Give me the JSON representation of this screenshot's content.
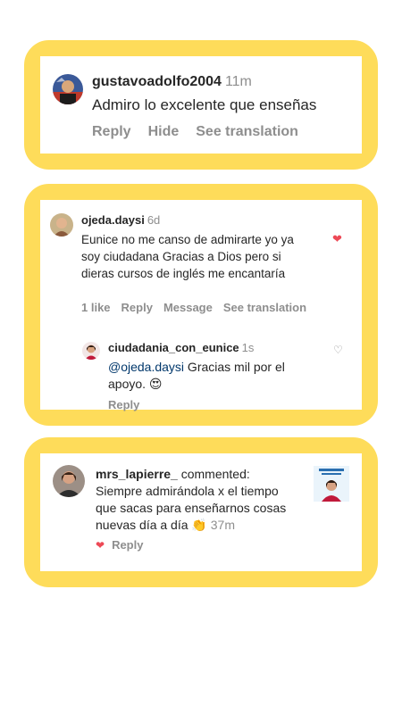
{
  "comment1": {
    "username": "gustavoadolfo2004",
    "time": "11m",
    "text": "Admiro lo excelente que enseñas",
    "actions": [
      "Reply",
      "Hide",
      "See translation"
    ]
  },
  "comment2": {
    "username": "ojeda.daysi",
    "time": "6d",
    "text": "Eunice no me canso de admirarte yo ya soy ciudadana Gracias a Dios pero si dieras cursos de inglés me encantaría",
    "actions": [
      "1 like",
      "Reply",
      "Message",
      "See translation"
    ],
    "liked_icon": "heart-filled-icon",
    "reply": {
      "username": "ciudadania_con_eunice",
      "time": "1s",
      "mention": "@ojeda.daysi",
      "text": " Gracias mil por el apoyo. 😍",
      "action": "Reply",
      "like_icon": "heart-outline-icon"
    }
  },
  "comment3": {
    "username": "mrs_lapierre_",
    "commented_label": " commented:",
    "text": "Siempre admirándola x el tiempo que sacas para enseñarnos cosas nuevas día a día 👏",
    "time": "37m",
    "action": "Reply",
    "liked_icon": "heart-filled-icon"
  },
  "colors": {
    "frame": "#fedc5a",
    "heart": "#ed4956",
    "secondary_text": "#8e8e8e",
    "mention": "#00376b"
  }
}
